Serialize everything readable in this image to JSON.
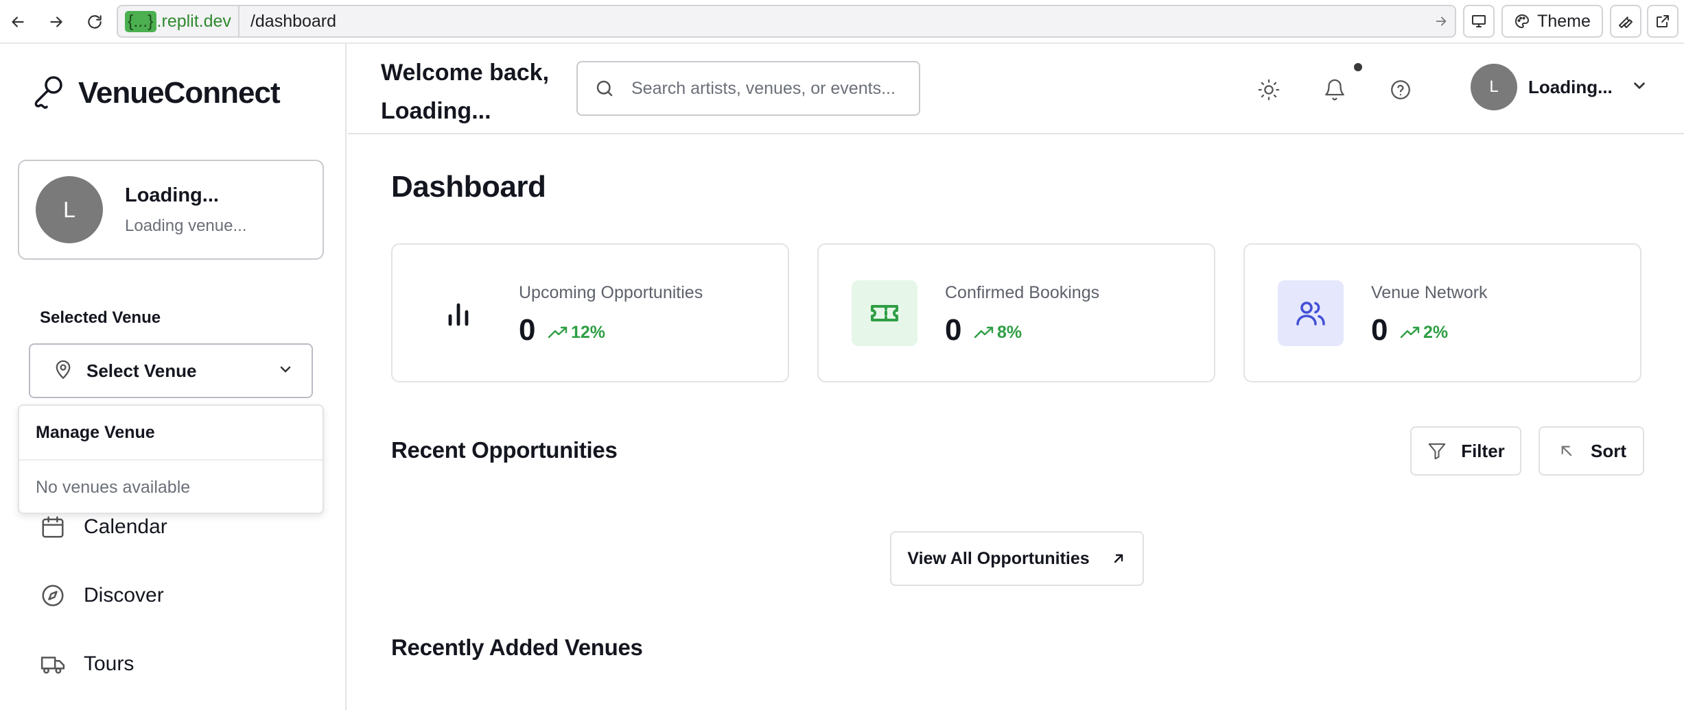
{
  "browser": {
    "host_pill": "{...}",
    "host": ".replit.dev",
    "path": "/dashboard",
    "theme_label": "Theme"
  },
  "sidebar": {
    "brand": "VenueConnect",
    "profile": {
      "initial": "L",
      "name": "Loading...",
      "venue": "Loading venue..."
    },
    "selected_venue_label": "Selected Venue",
    "select_placeholder": "Select Venue",
    "dropdown": {
      "header": "Manage Venue",
      "empty": "No venues available"
    },
    "nav": [
      {
        "label": "Calendar",
        "icon": "calendar-icon"
      },
      {
        "label": "Discover",
        "icon": "compass-icon"
      },
      {
        "label": "Tours",
        "icon": "truck-icon"
      }
    ]
  },
  "header": {
    "welcome": "Welcome back, Loading...",
    "search_placeholder": "Search artists, venues, or events...",
    "user_initial": "L",
    "user_name": "Loading..."
  },
  "main": {
    "title": "Dashboard",
    "stats": [
      {
        "label": "Upcoming Opportunities",
        "value": "0",
        "trend": "12%",
        "icon": "bar-chart-icon",
        "icon_bg": "#ffffff",
        "icon_color": "#14161f"
      },
      {
        "label": "Confirmed Bookings",
        "value": "0",
        "trend": "8%",
        "icon": "ticket-icon",
        "icon_bg": "#e6f7e9",
        "icon_color": "#2f9e44"
      },
      {
        "label": "Venue Network",
        "value": "0",
        "trend": "2%",
        "icon": "users-icon",
        "icon_bg": "#e5e8fc",
        "icon_color": "#4451d6"
      }
    ],
    "recent_opportunities_title": "Recent Opportunities",
    "filter_label": "Filter",
    "sort_label": "Sort",
    "view_all_label": "View All Opportunities",
    "recently_added_title": "Recently Added Venues"
  },
  "colors": {
    "trend_green": "#2f9e44",
    "avatar_gray": "#7a7a7a",
    "text_dark": "#14161f",
    "text_muted": "#6b6f78"
  }
}
